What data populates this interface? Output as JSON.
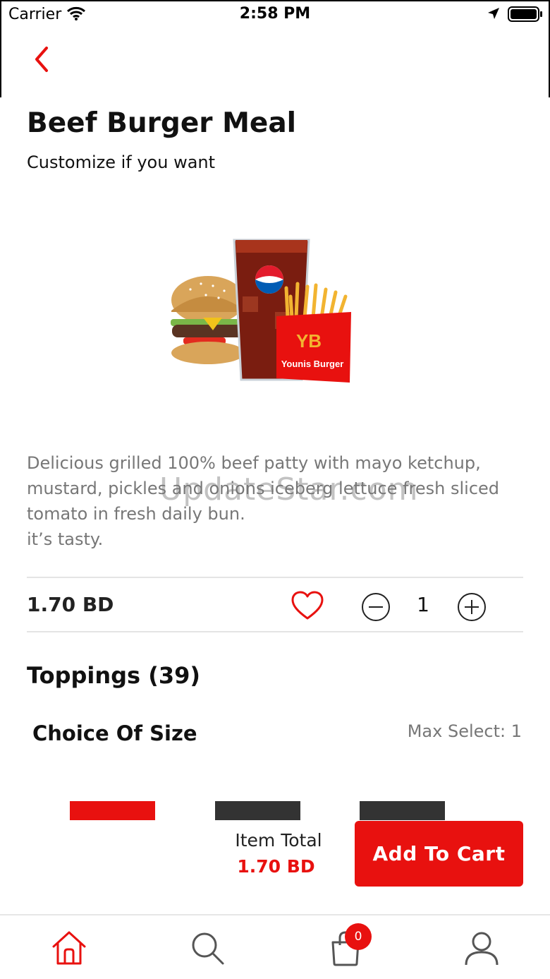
{
  "status_bar": {
    "carrier": "Carrier",
    "time": "2:58 PM"
  },
  "product": {
    "title": "Beef Burger Meal",
    "subtitle": "Customize if you want",
    "description": "Delicious grilled 100% beef patty with mayo ketchup, mustard, pickles and onions iceberg lettuce fresh sliced tomato in fresh daily bun.\nit’s tasty.",
    "image_brand_text": "Younis Burger",
    "price": "1.70 BD",
    "quantity": "1"
  },
  "watermark": "UpdateStar.com",
  "toppings": {
    "title": "Toppings (39)",
    "group_title": "Choice Of Size",
    "max_select": "Max Select: 1"
  },
  "footer": {
    "item_total_label": "Item Total",
    "item_total_value": "1.70 BD",
    "add_to_cart_label": "Add To Cart"
  },
  "tab_bar": {
    "cart_badge": "0",
    "items": [
      "home-icon",
      "search-icon",
      "cart-icon",
      "profile-icon"
    ]
  },
  "colors": {
    "accent": "#e8110f",
    "text_dark": "#111111",
    "text_muted": "#777777",
    "tab_dark": "#333333",
    "icon_gray": "#555555"
  }
}
